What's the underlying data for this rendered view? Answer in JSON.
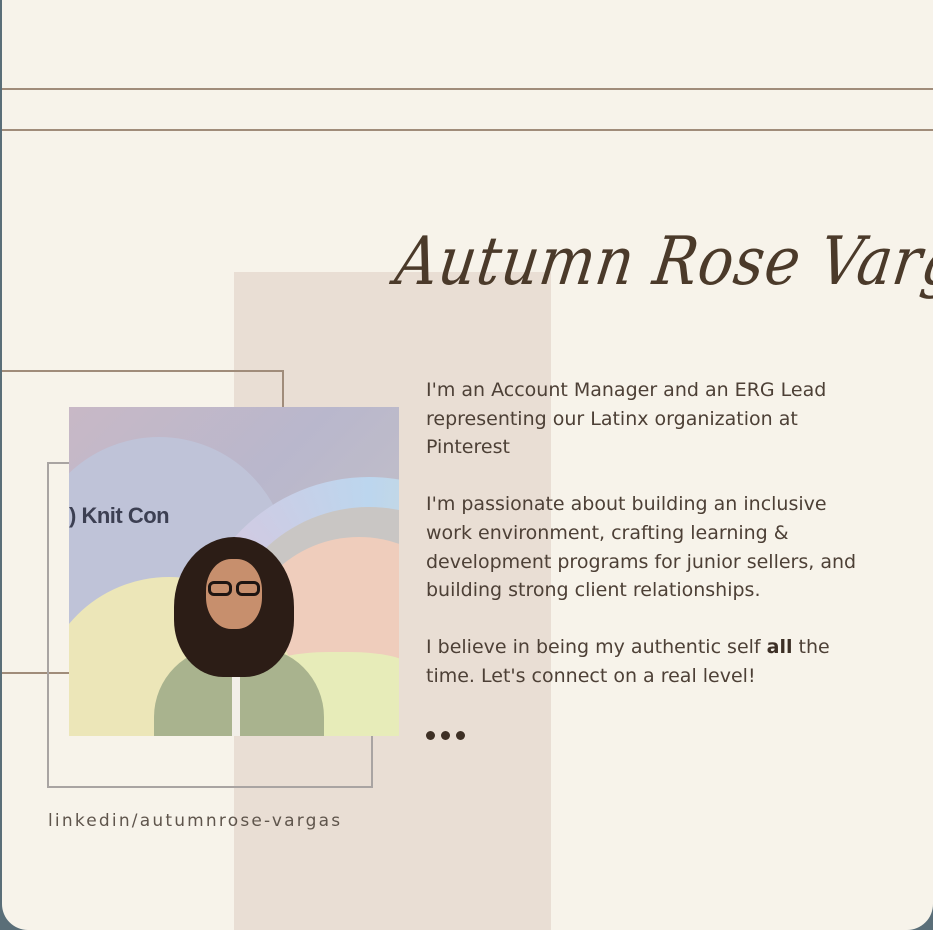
{
  "profile": {
    "name": "Autumn Rose Vargas",
    "bio": {
      "p1": "I'm an Account Manager and an ERG Lead representing our Latinx organization at Pinterest",
      "p2": "I'm passionate about building an inclusive work environment, crafting learning & development programs for junior sellers, and building strong client relationships.",
      "p3_before": "I believe in being my authentic self ",
      "p3_bold": "all",
      "p3_after": " the time. Let's connect on a real level!"
    },
    "linkedin": "linkedin/autumnrose-vargas",
    "photo_logo_text": ") Knit Con"
  },
  "icons": {
    "more": "more-dots-icon"
  },
  "colors": {
    "card_background": "#f7f3ea",
    "accent_band": "#e9ded4",
    "line_brown": "#a08c7a",
    "text_dark": "#4d4036"
  }
}
